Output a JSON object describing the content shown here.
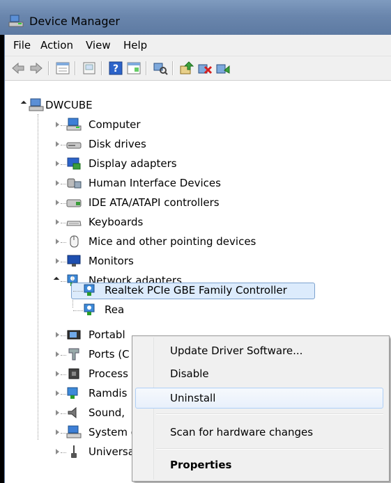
{
  "window": {
    "title": "Device Manager"
  },
  "menu": [
    "File",
    "Action",
    "View",
    "Help"
  ],
  "toolbar": [
    "back-icon",
    "forward-icon",
    "properties-list-icon",
    "show-hidden-icon",
    "help-icon",
    "properties-window-icon",
    "scan-hardware-icon",
    "update-driver-icon",
    "uninstall-icon",
    "enable-device-icon"
  ],
  "tree": {
    "root": "DWCUBE",
    "categories": [
      {
        "label": "Computer",
        "icon": "computer-icon"
      },
      {
        "label": "Disk drives",
        "icon": "disk-drive-icon"
      },
      {
        "label": "Display adapters",
        "icon": "display-adapter-icon"
      },
      {
        "label": "Human Interface Devices",
        "icon": "hid-icon"
      },
      {
        "label": "IDE ATA/ATAPI controllers",
        "icon": "ide-controller-icon"
      },
      {
        "label": "Keyboards",
        "icon": "keyboard-icon"
      },
      {
        "label": "Mice and other pointing devices",
        "icon": "mouse-icon"
      },
      {
        "label": "Monitors",
        "icon": "monitor-icon"
      },
      {
        "label": "Network adapters",
        "icon": "network-adapter-icon",
        "expanded": true,
        "children": [
          "Realtek PCIe GBE Family Controller",
          "Rea"
        ]
      },
      {
        "label": "Portabl",
        "icon": "portable-device-icon"
      },
      {
        "label": "Ports (C",
        "icon": "port-icon"
      },
      {
        "label": "Process",
        "icon": "processor-icon"
      },
      {
        "label": "Ramdis",
        "icon": "ramdisk-icon"
      },
      {
        "label": "Sound,",
        "icon": "sound-icon"
      },
      {
        "label": "System devices",
        "icon": "system-device-icon"
      },
      {
        "label": "Universal Serial Bus controllers",
        "icon": "usb-icon"
      }
    ]
  },
  "context_menu": {
    "items": [
      {
        "label": "Update Driver Software..."
      },
      {
        "label": "Disable"
      },
      {
        "label": "Uninstall",
        "highlighted": true
      },
      {
        "label": "Scan for hardware changes"
      },
      {
        "label": "Properties",
        "bold": true
      }
    ]
  }
}
